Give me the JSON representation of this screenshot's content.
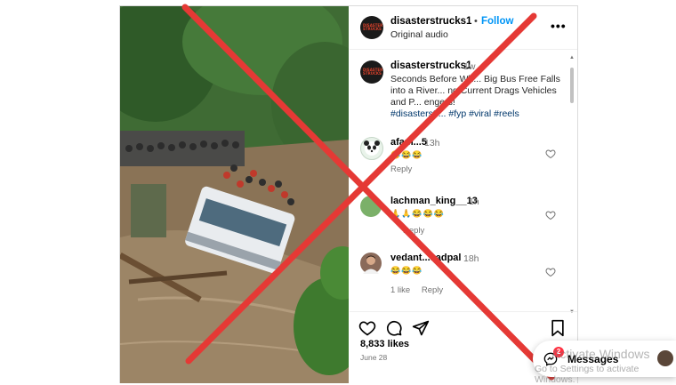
{
  "post": {
    "username": "disasterstrucks1",
    "follow_label": "Follow",
    "separator": "•",
    "audio": "Original audio",
    "avatar_text": "DISASTER STRUCKS",
    "more_icon": "more-horizontal-icon"
  },
  "caption": {
    "username": "disasterstrucks1",
    "age": "1w",
    "text": "Seconds Before Wh... Big Bus Free Falls into a River... ng Current Drags Vehicles and P... engers!",
    "hashtags": "#disasterstr... #fyp #viral #reels"
  },
  "comments": [
    {
      "username": "afam...5",
      "age": "13h",
      "emoji": "😂😂😂",
      "actions": [
        "Reply"
      ]
    },
    {
      "username": "lachman_king__13",
      "age": "1h",
      "emoji": "🙏🙏😂😂😂",
      "actions": [
        "Reply"
      ]
    },
    {
      "username": "vedant...sadpal",
      "age": "18h",
      "emoji": "😂😂😂",
      "actions": [
        "1 like",
        "Reply"
      ]
    }
  ],
  "engagement": {
    "likes": "8,833 likes",
    "date": "June 28"
  },
  "messages": {
    "label": "Messages",
    "badge": "2"
  },
  "watermark": {
    "line1": "Activate Windows",
    "line2": "Go to Settings to activate Windows."
  },
  "colors": {
    "follow": "#0095f6",
    "cross": "#e53935",
    "badge": "#ff3040"
  }
}
